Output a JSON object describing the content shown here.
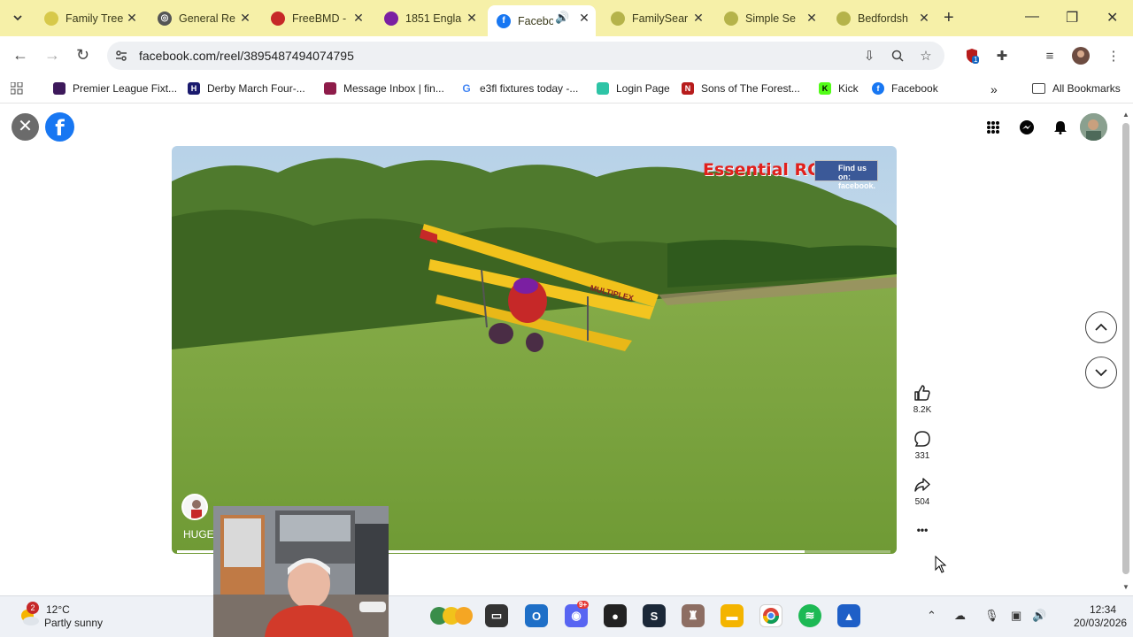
{
  "browser": {
    "tabs": [
      {
        "title": "Family Tree",
        "icon": "family-tree-icon",
        "color": "#d7c94a"
      },
      {
        "title": "General Re",
        "icon": "globe-icon",
        "color": "#555555"
      },
      {
        "title": "FreeBMD -",
        "icon": "freebmd-icon",
        "color": "#c62828"
      },
      {
        "title": "1851 Engla",
        "icon": "census-icon",
        "color": "#7b1fa2"
      },
      {
        "title": "Facebo",
        "icon": "facebook-icon",
        "color": "#1877f2",
        "active": true
      },
      {
        "title": "FamilySear",
        "icon": "familysearch-icon",
        "color": "#b5b34a"
      },
      {
        "title": "Simple Se",
        "icon": "familysearch-icon",
        "color": "#b5b34a"
      },
      {
        "title": "Bedfordsh",
        "icon": "familysearch-icon",
        "color": "#b5b34a"
      }
    ],
    "url": "facebook.com/reel/3895487494074795",
    "extension_badge": "1",
    "bookmarks": [
      {
        "label": "Premier League Fixt...",
        "icon": "premier-league-icon",
        "color": "#3d195b"
      },
      {
        "label": "Derby March Four-...",
        "icon": "derby-icon",
        "color": "#1a1a6e"
      },
      {
        "label": "Message Inbox | fin...",
        "icon": "inbox-icon",
        "color": "#8e1c4a"
      },
      {
        "label": "e3fl fixtures today -...",
        "icon": "google-icon",
        "color": "#4285f4"
      },
      {
        "label": "Login Page",
        "icon": "login-icon",
        "color": "#2ec4a6"
      },
      {
        "label": "Sons of The Forest...",
        "icon": "netflix-icon",
        "color": "#b71c1c"
      },
      {
        "label": "Kick",
        "icon": "kick-icon",
        "color": "#53fc18"
      },
      {
        "label": "Facebook",
        "icon": "facebook-icon",
        "color": "#1877f2"
      }
    ],
    "all_bookmarks": "All Bookmarks"
  },
  "reel": {
    "brand_text": "Essential RC",
    "brand_fb_text": "Find us on: facebook.",
    "caption": "HUGE",
    "progress": 0.88,
    "likes": "8.2K",
    "comments": "331",
    "shares": "504",
    "more": "•••"
  },
  "taskbar": {
    "weather_badge": "2",
    "temp": "12°C",
    "weather": "Partly sunny",
    "time": "12:34",
    "date": "20/03/2026",
    "discord_badge": "9+"
  }
}
